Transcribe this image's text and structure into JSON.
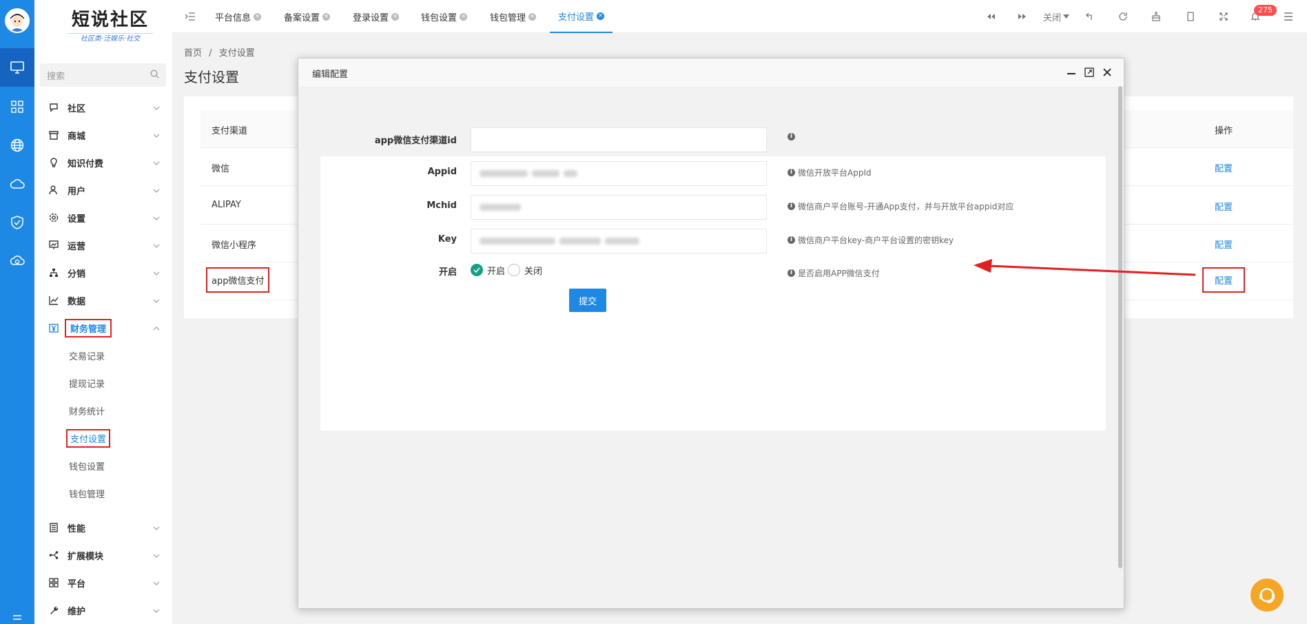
{
  "logo": {
    "title": "短说社区",
    "subtitle": "社区类·泛娱乐·社交"
  },
  "search": {
    "placeholder": "搜索"
  },
  "menu": [
    {
      "label": "社区"
    },
    {
      "label": "商城"
    },
    {
      "label": "知识付费"
    },
    {
      "label": "用户"
    },
    {
      "label": "设置"
    },
    {
      "label": "运营"
    },
    {
      "label": "分销"
    },
    {
      "label": "数据"
    },
    {
      "label": "财务管理"
    },
    {
      "label": "性能"
    },
    {
      "label": "扩展模块"
    },
    {
      "label": "平台"
    },
    {
      "label": "维护"
    }
  ],
  "submenu": [
    {
      "label": "交易记录"
    },
    {
      "label": "提现记录"
    },
    {
      "label": "财务统计"
    },
    {
      "label": "支付设置"
    },
    {
      "label": "钱包设置"
    },
    {
      "label": "钱包管理"
    }
  ],
  "tabs": [
    {
      "label": "平台信息"
    },
    {
      "label": "备案设置"
    },
    {
      "label": "登录设置"
    },
    {
      "label": "钱包设置"
    },
    {
      "label": "钱包管理"
    },
    {
      "label": "支付设置"
    }
  ],
  "toolbar": {
    "close_label": "关闭",
    "notification_count": "275"
  },
  "breadcrumb": {
    "home": "首页",
    "sep": "/",
    "current": "支付设置"
  },
  "page_title": "支付设置",
  "table": {
    "header_channel": "支付渠道",
    "header_action": "操作",
    "rows": [
      {
        "channel": "微信",
        "action": "配置"
      },
      {
        "channel": "ALIPAY",
        "action": "配置"
      },
      {
        "channel": "微信小程序",
        "action": "配置"
      },
      {
        "channel": "app微信支付",
        "action": "配置"
      }
    ]
  },
  "modal": {
    "title": "编辑配置",
    "fields": [
      {
        "label": "app微信支付渠道id",
        "value": "",
        "tip": ""
      },
      {
        "label": "Appid",
        "value": "",
        "tip": "微信开放平台AppId"
      },
      {
        "label": "Mchid",
        "value": "",
        "tip": "微信商户平台账号-开通App支付，并与开放平台appid对应"
      },
      {
        "label": "Key",
        "value": "",
        "tip": "微信商户平台key-商户平台设置的密钥key"
      }
    ],
    "switch": {
      "label": "开启",
      "on_label": "开启",
      "off_label": "关闭",
      "tip": "是否启用APP微信支付"
    },
    "submit_label": "提交"
  },
  "colors": {
    "primary": "#1e88e5",
    "rail": "#1e88e5",
    "highlight": "#e02020",
    "radio_on": "#16a085"
  }
}
